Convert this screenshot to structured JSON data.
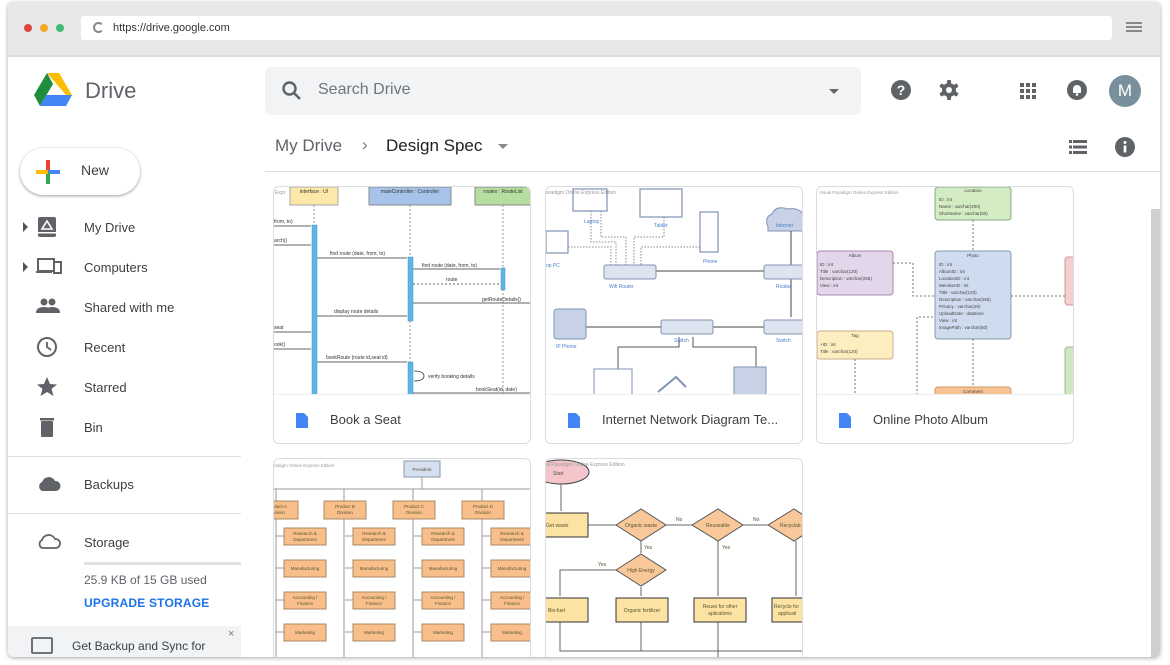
{
  "browser": {
    "url": "https://drive.google.com",
    "traffic_colors": [
      "#e0443e",
      "#f5a623",
      "#3dbb72"
    ]
  },
  "app": {
    "name": "Drive",
    "search_placeholder": "Search Drive",
    "avatar_initial": "M",
    "avatar_color": "#78909c",
    "header_icons": [
      "help-icon",
      "settings-icon",
      "apps-grid-icon",
      "notifications-icon"
    ]
  },
  "sidebar": {
    "new_label": "New",
    "items": [
      {
        "label": "My Drive",
        "icon": "my-drive-icon",
        "expandable": true
      },
      {
        "label": "Computers",
        "icon": "computers-icon",
        "expandable": true
      },
      {
        "label": "Shared with me",
        "icon": "shared-icon",
        "expandable": false
      },
      {
        "label": "Recent",
        "icon": "clock-icon",
        "expandable": false
      },
      {
        "label": "Starred",
        "icon": "star-icon",
        "expandable": false
      },
      {
        "label": "Bin",
        "icon": "trash-icon",
        "expandable": false
      }
    ],
    "backups_label": "Backups",
    "storage_label": "Storage",
    "storage_used_text": "25.9 KB of 15 GB used",
    "storage_used_fraction": 1.7e-06,
    "upgrade_label": "UPGRADE STORAGE",
    "promo_text": "Get Backup and Sync for",
    "promo_close": "×"
  },
  "breadcrumb": {
    "root": "My Drive",
    "separator": "›",
    "current": "Design Spec"
  },
  "files": [
    {
      "name": "Book a Seat",
      "type": "sequence-diagram"
    },
    {
      "name": "Internet Network Diagram Te...",
      "type": "network-diagram"
    },
    {
      "name": "Online Photo Album",
      "type": "erd-diagram"
    },
    {
      "name": "",
      "type": "org-chart"
    },
    {
      "name": "",
      "type": "flowchart"
    }
  ],
  "thumbs": {
    "seq": {
      "watermark": "Expr",
      "lifelines": [
        "interface : UI",
        "mainController : Controller",
        "routes : RouteList"
      ],
      "messages": [
        "from, to)",
        "arch()",
        "find route (date, from, to)",
        "find route (date, from, to)",
        "route",
        "getRouteDetails()",
        "display route details",
        "seat",
        "ook()",
        "bookRoute (route id,seat id)",
        "verify booking details",
        "bookSeat(id, date)"
      ]
    },
    "net": {
      "watermark": "aradigm Online Express Edition",
      "labels": [
        "Laptop",
        "Tablet",
        "Phone",
        "Internet",
        "op PC",
        "Wifi Router",
        "Router",
        "IP Phone",
        "Switch",
        "Switch"
      ]
    },
    "erd": {
      "watermark": "Visual Paradigm Online Express Edition",
      "location": {
        "title": "Location",
        "fields": [
          "ID : int",
          "Name : varchar(200)",
          "Shortname : varchar(50)"
        ]
      },
      "album": {
        "title": "Album",
        "fields": [
          "ID : int",
          "Title : varchar(120)",
          "Description : varchar(255)",
          "View : int"
        ]
      },
      "photo": {
        "title": "Photo",
        "fields": [
          "ID : int",
          "AlbumID : int",
          "LocationID : int",
          "MemberID : int",
          "Title : varchar(120)",
          "Description : varchar(255)",
          "Privacy : varchar(20)",
          "UploadDate : datetime",
          "View : int",
          "ImagePath : varchar(50)"
        ]
      },
      "tag": {
        "title": "Tag",
        "fields": [
          "+ID : int",
          "Title : varchar(120)"
        ]
      },
      "comment": {
        "title": "Comment"
      }
    },
    "org": {
      "watermark": "radigm Online Express Edition",
      "president": "President",
      "divisions": [
        [
          "Product A",
          "Division"
        ],
        [
          "Product B",
          "Division"
        ],
        [
          "Product C",
          "Division"
        ],
        [
          "Product D",
          "Division"
        ]
      ],
      "departments": [
        [
          "Research &",
          "Department"
        ],
        [
          "Manufacturing"
        ],
        [
          "Accounting /",
          "Finance"
        ],
        [
          "Marketing"
        ]
      ]
    },
    "flow": {
      "watermark": "al Paradigm Online Express Edition",
      "start": "Start",
      "get_waste": "Get waste",
      "organic": "Organic waste",
      "reusable": "Reuseable",
      "recyclable": "Recyclab",
      "high_energy": "High Energy",
      "biofuel": "Bio-fuel",
      "fertilizer": "Organic fertilizer",
      "reuse": [
        "Reuse for other",
        "aplications"
      ],
      "recycle": [
        "Recycle for",
        "applicati"
      ],
      "yes": "Yes",
      "no": "No"
    }
  }
}
